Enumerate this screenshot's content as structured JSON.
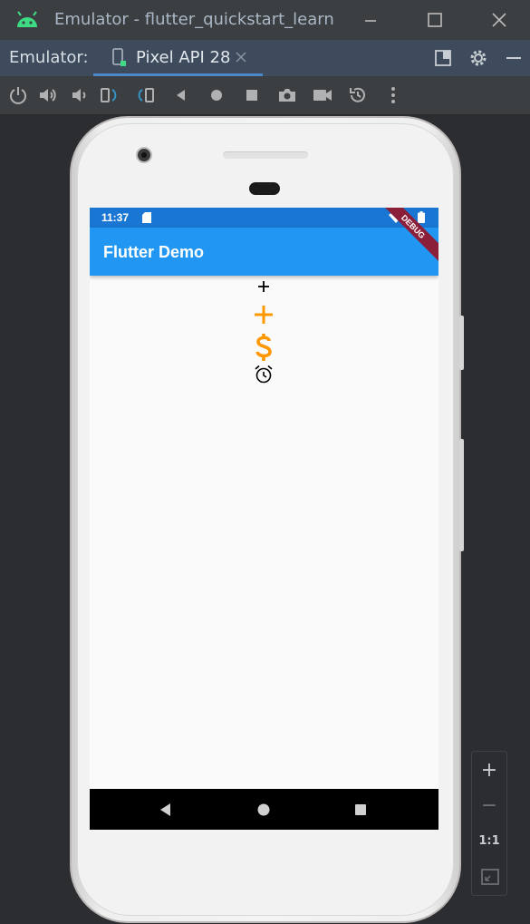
{
  "window": {
    "title": "Emulator - flutter_quickstart_learn",
    "icons": [
      "android-logo",
      "minimize-icon",
      "maximize-icon",
      "close-icon"
    ]
  },
  "tabbar": {
    "label": "Emulator:",
    "active_tab": "Pixel API 28",
    "icons": [
      "device-icon",
      "tab-close-icon",
      "window-mode-icon",
      "settings-gear-icon",
      "hide-icon"
    ]
  },
  "toolbar": {
    "tools": [
      "power",
      "volume-up",
      "volume-down",
      "rotate-left",
      "rotate-right",
      "back",
      "home",
      "overview",
      "screenshot",
      "screen-record",
      "snapshot",
      "more"
    ]
  },
  "phone": {
    "status_time": "11:37",
    "app_title": "Flutter Demo",
    "debug_banner": "DEBUG",
    "body_icons": [
      {
        "name": "add",
        "color": "#000000"
      },
      {
        "name": "add",
        "color": "#ff9800"
      },
      {
        "name": "attach-money",
        "color": "#ff9800"
      },
      {
        "name": "access-alarm",
        "color": "#000000"
      }
    ],
    "nav_buttons": [
      "back",
      "home",
      "recents"
    ]
  },
  "zoom": {
    "zoom_in": "+",
    "zoom_out": "−",
    "one_to_one": "1:1",
    "fit": "fit-screen"
  },
  "colors": {
    "status_bar": "#1976d2",
    "app_bar": "#2196f3",
    "accent_orange": "#ff9800",
    "ide_blue": "#4a88c7"
  }
}
